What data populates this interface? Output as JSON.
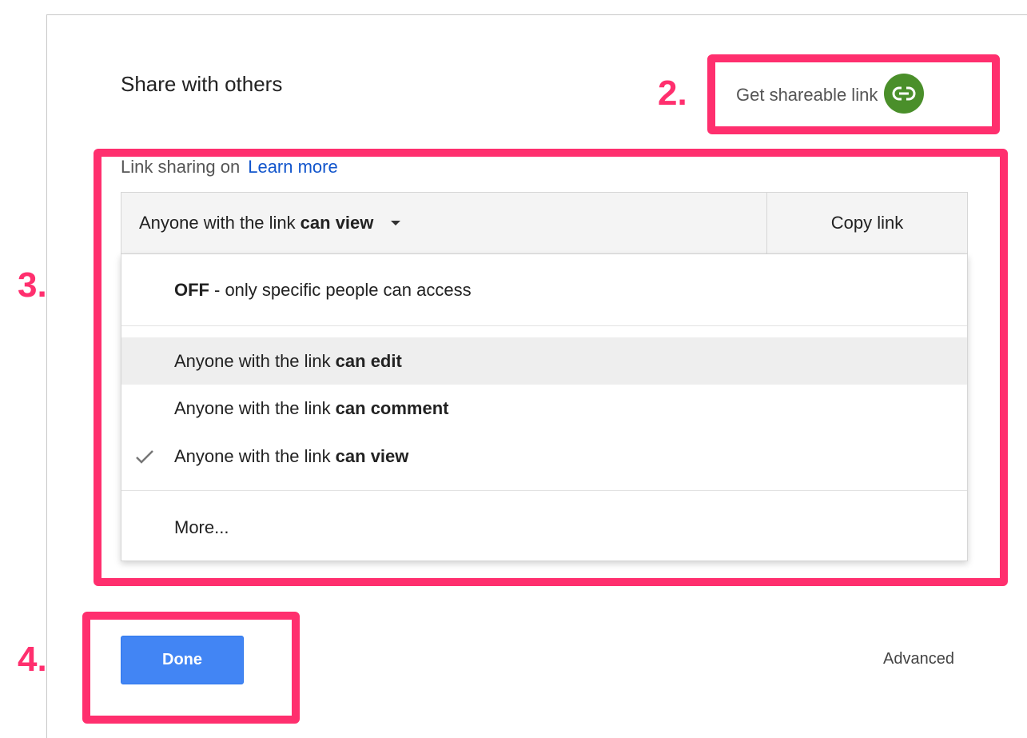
{
  "dialog": {
    "title": "Share with others",
    "get_link_label": "Get shareable link",
    "link_sharing": {
      "status": "Link sharing on",
      "learn_more": "Learn more"
    },
    "permission": {
      "prefix": "Anyone with the link",
      "selected": "can view",
      "copy_link": "Copy link"
    },
    "menu": {
      "off": {
        "bold": "OFF",
        "text": "- only specific people can access"
      },
      "options": [
        {
          "prefix": "Anyone with the link",
          "bold": "can edit",
          "highlighted": true,
          "checked": false
        },
        {
          "prefix": "Anyone with the link",
          "bold": "can comment",
          "highlighted": false,
          "checked": false
        },
        {
          "prefix": "Anyone with the link",
          "bold": "can view",
          "highlighted": false,
          "checked": true
        }
      ],
      "more": "More..."
    },
    "done_label": "Done",
    "advanced_label": "Advanced"
  },
  "annotations": {
    "step2": "2.",
    "step3": "3.",
    "step4": "4.",
    "color": "#ff2f6e"
  },
  "icons": {
    "link": "link-icon",
    "caret": "caret-down-icon",
    "check": "checkmark-icon"
  },
  "colors": {
    "primary_button": "#4285f4",
    "link_text": "#1155cc",
    "link_icon_bg": "#4a8f2a",
    "highlighted_row": "#eeeeee"
  }
}
